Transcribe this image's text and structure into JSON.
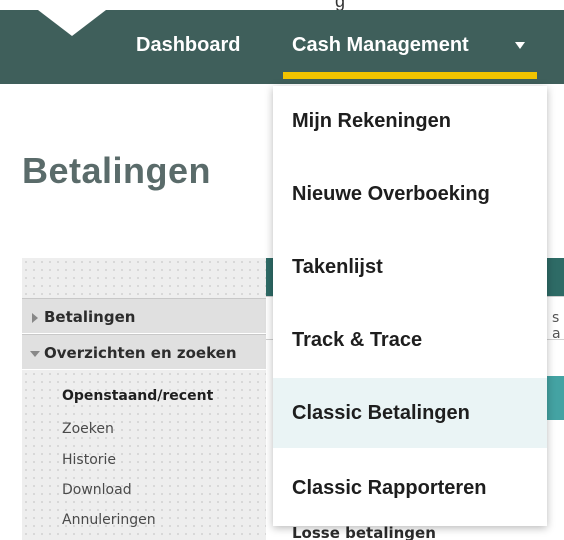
{
  "header": {
    "top_partial_text": "g",
    "nav": [
      {
        "label": "Dashboard"
      },
      {
        "label": "Cash Management"
      }
    ]
  },
  "page": {
    "title": "Betalingen"
  },
  "sidebar": {
    "sections": [
      {
        "label": "Betalingen",
        "expanded": false
      },
      {
        "label": "Overzichten en zoeken",
        "expanded": true
      }
    ],
    "links": [
      {
        "label": "Openstaand/recent",
        "active": true
      },
      {
        "label": "Zoeken",
        "active": false
      },
      {
        "label": "Historie",
        "active": false
      },
      {
        "label": "Download",
        "active": false
      },
      {
        "label": "Annuleringen",
        "active": false
      }
    ]
  },
  "background": {
    "input_partial_text": "s a",
    "losse_label": "Losse betalingen"
  },
  "dropdown": {
    "items": [
      {
        "label": "Mijn Rekeningen",
        "highlighted": false
      },
      {
        "label": "Nieuwe Overboeking",
        "highlighted": false
      },
      {
        "label": "Takenlijst",
        "highlighted": false
      },
      {
        "label": "Track & Trace",
        "highlighted": false
      },
      {
        "label": "Classic Betalingen",
        "highlighted": true
      },
      {
        "label": "Classic Rapporteren",
        "highlighted": false
      }
    ]
  },
  "colors": {
    "navbar": "#3f5f5b",
    "accent_underline": "#f2c300",
    "highlight": "#eaf4f5",
    "teal": "#2e6b66"
  },
  "icons": {
    "dropdown_caret": "caret-down-icon",
    "section_collapsed": "triangle-right-icon",
    "section_expanded": "triangle-down-icon"
  }
}
